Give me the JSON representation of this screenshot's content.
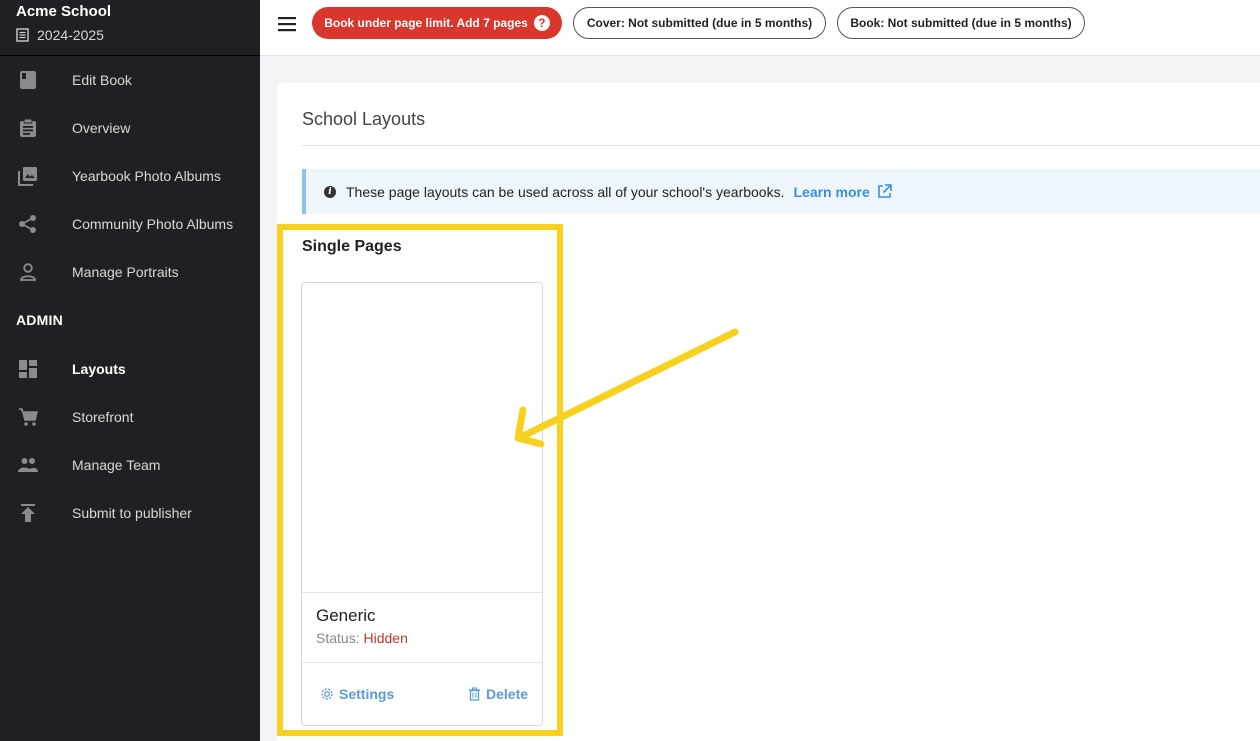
{
  "school": {
    "name": "Acme School",
    "year": "2024-2025"
  },
  "sidebar": {
    "items": [
      {
        "label": "Edit Book",
        "icon": "book-icon"
      },
      {
        "label": "Overview",
        "icon": "clipboard-icon"
      },
      {
        "label": "Yearbook Photo Albums",
        "icon": "photo-library-icon"
      },
      {
        "label": "Community Photo Albums",
        "icon": "share-icon"
      },
      {
        "label": "Manage Portraits",
        "icon": "person-icon"
      }
    ],
    "admin_title": "ADMIN",
    "admin_items": [
      {
        "label": "Layouts",
        "icon": "dashboard-icon"
      },
      {
        "label": "Storefront",
        "icon": "cart-icon"
      },
      {
        "label": "Manage Team",
        "icon": "people-icon"
      },
      {
        "label": "Submit to publisher",
        "icon": "upload-icon"
      }
    ]
  },
  "topbar": {
    "alert": "Book under page limit. Add 7 pages",
    "alert_help": "?",
    "cover_status": "Cover: Not submitted (due in 5 months)",
    "book_status": "Book: Not submitted (due in 5 months)"
  },
  "main": {
    "title": "School Layouts",
    "info_text": "These page layouts can be used across all of your school's yearbooks.",
    "info_link": "Learn more",
    "section_title": "Single Pages",
    "layouts": [
      {
        "name": "Generic",
        "status_label": "Status:",
        "status_value": "Hidden",
        "settings_label": "Settings",
        "delete_label": "Delete"
      }
    ]
  },
  "colors": {
    "highlight": "#f7d11e",
    "alert": "#d9372d",
    "link": "#3b8de0",
    "hidden_status": "#c0392b"
  }
}
